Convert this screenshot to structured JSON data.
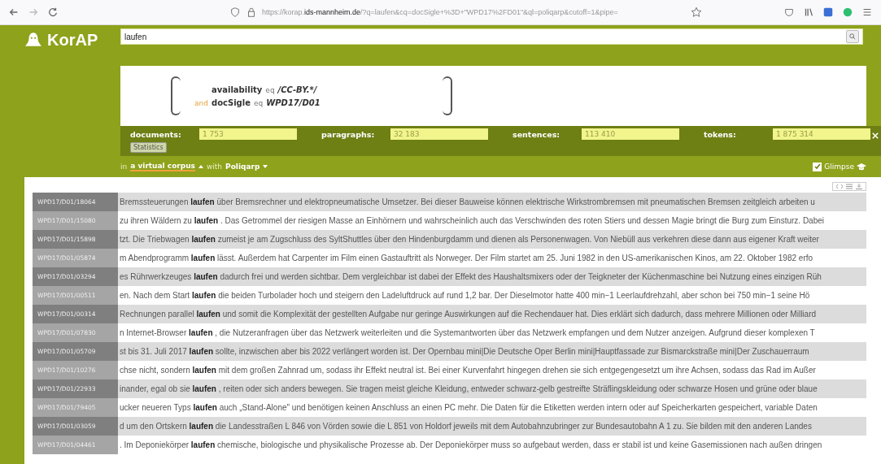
{
  "browser": {
    "url_prefix": "https://korap.",
    "url_host": "ids-mannheim.de",
    "url_rest": "/?q=laufen&cq=docSigle+%3D+\"WPD17%2FD01\"&ql=poliqarp&cutoff=1&pipe="
  },
  "logo": {
    "text": "KorAP"
  },
  "search": {
    "value": "laufen"
  },
  "vc": {
    "rules": [
      {
        "key": "availability",
        "op": "eq",
        "value": "/CC-BY.*/"
      },
      {
        "key": "docSigle",
        "op": "eq",
        "value": "WPD17/D01"
      }
    ],
    "operator": "and"
  },
  "stats": [
    {
      "label": "documents:",
      "value": "1 753"
    },
    {
      "label": "paragraphs:",
      "value": "32 183"
    },
    {
      "label": "sentences:",
      "value": "113 410"
    },
    {
      "label": "tokens:",
      "value": "1 875 314"
    }
  ],
  "statistics_button": "Statistics",
  "corpus_bar": {
    "in": "in",
    "corpus": "a virtual corpus",
    "with": "with",
    "lang": "Poliqarp",
    "glimpse": "Glimpse",
    "glimpse_checked": true
  },
  "results": [
    {
      "id": "WPD17/D01/18064",
      "left": "Bremssteuerungen",
      "match": "laufen",
      "right": "über Bremsrechner und elektropneumatische Umsetzer. Bei dieser Bauweise können elektrische Wirkstrombremsen mit pneumatischen Bremsen zeitgleich arbeiten u"
    },
    {
      "id": "WPD17/D01/15080",
      "left": "zu ihren Wäldern zu",
      "match": "laufen",
      "right": ". Das Getrommel der riesigen Masse an Einhörnern und wahrscheinlich auch das Verschwinden des roten Stiers und dessen Magie bringt die Burg zum Einsturz. Dabei"
    },
    {
      "id": "WPD17/D01/15898",
      "left": "tzt. Die Triebwagen",
      "match": "laufen",
      "right": "zumeist je am Zugschluss des SyltShuttles über den Hindenburgdamm und dienen als Personenwagen. Von Niebüll aus verkehren diese dann aus eigener Kraft weiter"
    },
    {
      "id": "WPD17/D01/05874",
      "left": "m Abendprogramm",
      "match": "laufen",
      "right": "lässt. Außerdem hat Carpenter im Film einen Gastauftritt als Norweger. Der Film startet am 25. Juni 1982 in den US-amerikanischen Kinos, am 22. Oktober 1982 erfo"
    },
    {
      "id": "WPD17/D01/03294",
      "left": "es Rührwerkzeuges",
      "match": "laufen",
      "right": "dadurch frei und werden sichtbar. Dem vergleichbar ist dabei der Effekt des Haushaltsmixers oder der Teigkneter der Küchenmaschine bei Nutzung eines einzigen Rüh"
    },
    {
      "id": "WPD17/D01/00511",
      "left": "en. Nach dem Start",
      "match": "laufen",
      "right": "die beiden Turbolader hoch und steigern den Ladeluftdruck auf rund 1,2 bar. Der Dieselmotor hatte 400 min−1 Leerlaufdrehzahl, aber schon bei 750 min−1 seine Hö"
    },
    {
      "id": "WPD17/D01/00314",
      "left": "Rechnungen parallel",
      "match": "laufen",
      "right": "und somit die Komplexität der gestellten Aufgabe nur geringe Auswirkungen auf die Rechendauer hat. Dies erklärt sich dadurch, dass mehrere Millionen oder Milliard"
    },
    {
      "id": "WPD17/D01/07830",
      "left": "n Internet-Browser",
      "match": "laufen",
      "right": ", die Nutzeranfragen über das Netzwerk weiterleiten und die Systemantworten über das Netzwerk empfangen und dem Nutzer anzeigen. Aufgrund dieser komplexen T"
    },
    {
      "id": "WPD17/D01/05709",
      "left": "st bis 31. Juli 2017",
      "match": "laufen",
      "right": "sollte, inzwischen aber bis 2022 verlängert worden ist. Der Opernbau mini|Die Deutsche Oper Berlin mini|Hauptfassade zur Bismarckstraße mini|Der Zuschauerraum"
    },
    {
      "id": "WPD17/D01/10276",
      "left": "chse nicht, sondern",
      "match": "laufen",
      "right": "mit dem großen Zahnrad um, sodass ihr Effekt neutral ist. Bei einer Kurvenfahrt hingegen drehen sie sich entgegengesetzt um ihre Achsen, sodass das Rad im Außer"
    },
    {
      "id": "WPD17/D01/22933",
      "left": "inander, egal ob sie",
      "match": "laufen",
      "right": ", reiten oder sich anders bewegen. Sie tragen meist gleiche Kleidung, entweder schwarz-gelb gestreifte Sträflingskleidung oder schwarze Hosen und grüne oder blaue"
    },
    {
      "id": "WPD17/D01/79405",
      "left": "ucker neueren Typs",
      "match": "laufen",
      "right": "auch „Stand-Alone\" und benötigen keinen Anschluss an einen PC mehr. Die Daten für die Etiketten werden intern oder auf Speicherkarten gespeichert, variable Daten"
    },
    {
      "id": "WPD17/D01/03059",
      "left": "d um den Ortskern",
      "match": "laufen",
      "right": "die Landesstraßen L 846 von Vörden sowie die L 851 von Holdorf jeweils mit dem Autobahnzubringer zur Bundesautobahn A 1 zu. Sie bilden mit den anderen Landes"
    },
    {
      "id": "WPD17/D01/04461",
      "left": ". Im Deponiekörper",
      "match": "laufen",
      "right": "chemische, biologische und physikalische Prozesse ab. Der Deponiekörper muss so aufgebaut werden, dass er stabil ist und keine Gasemissionen nach außen dringen"
    }
  ]
}
